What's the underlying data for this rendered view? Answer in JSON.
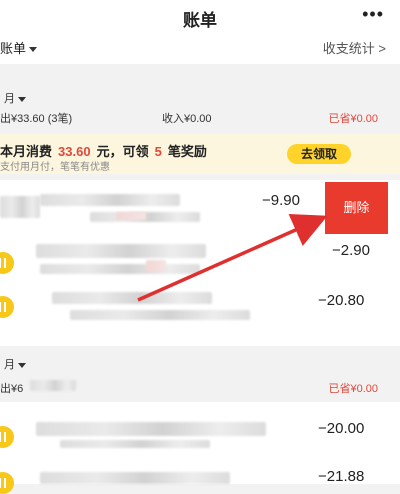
{
  "header": {
    "title": "账单",
    "more_icon": "more-horizontal-icon"
  },
  "subheader": {
    "bill_filter": "账单",
    "stats_link": "收支统计 >"
  },
  "month1": {
    "label": "月",
    "expense": "出¥33.60 (3笔)",
    "income": "收入¥0.00",
    "saved": "已省¥0.00"
  },
  "banner": {
    "prefix": "本月消费",
    "spent": "33.60",
    "mid": "元，可领",
    "count": "5",
    "suffix": "笔奖励",
    "sub": "支付用月付，笔笔有优惠",
    "claim_label": "去领取"
  },
  "transactions": [
    {
      "amount": "−9.90"
    },
    {
      "amount": "−2.90"
    },
    {
      "amount": "−20.80"
    }
  ],
  "delete_label": "删除",
  "month2": {
    "label": "月",
    "expense": "出¥6",
    "saved": "已省¥0.00"
  },
  "transactions2": [
    {
      "amount": "−20.00"
    },
    {
      "amount": "−21.88"
    }
  ],
  "colors": {
    "accent_red": "#e93a2e",
    "banner_bg": "#fdf6df",
    "coin_yellow": "#f7c81a",
    "arrow_red": "#e02f2f"
  }
}
